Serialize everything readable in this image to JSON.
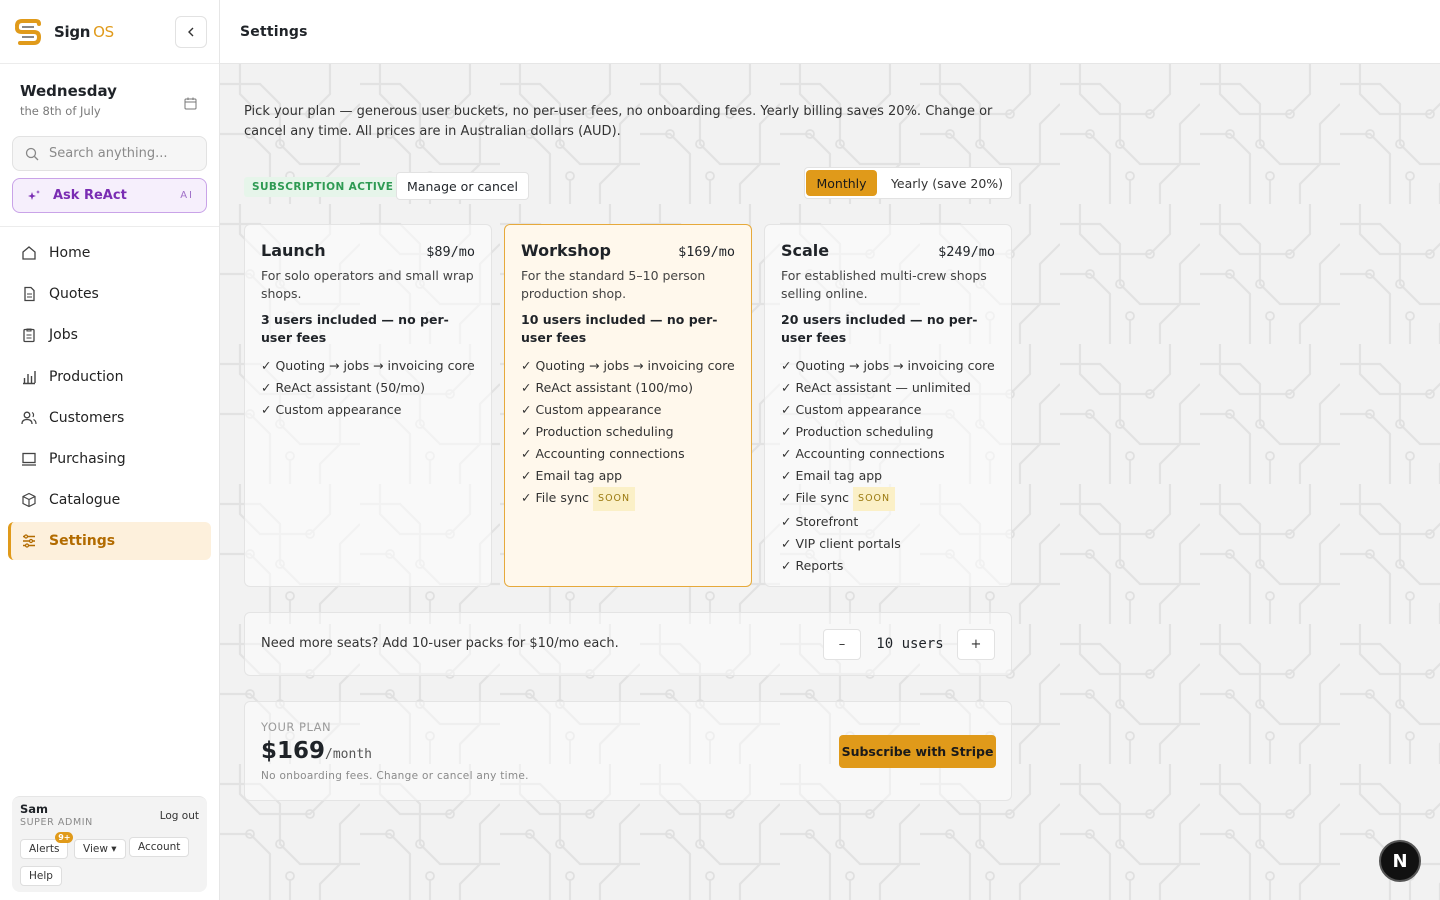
{
  "brand": {
    "name": "Sign",
    "suffix": "OS"
  },
  "header": {
    "title": "Settings"
  },
  "date": {
    "day": "Wednesday",
    "sub": "the 8th of July"
  },
  "search": {
    "placeholder": "Search anything..."
  },
  "ask": {
    "label": "Ask ReAct",
    "tag": "AI"
  },
  "sidebar": {
    "items": [
      {
        "label": "Home",
        "icon": "home-icon"
      },
      {
        "label": "Quotes",
        "icon": "document-icon"
      },
      {
        "label": "Jobs",
        "icon": "clipboard-icon"
      },
      {
        "label": "Production",
        "icon": "bar-chart-icon"
      },
      {
        "label": "Customers",
        "icon": "users-icon"
      },
      {
        "label": "Purchasing",
        "icon": "monitor-icon"
      },
      {
        "label": "Catalogue",
        "icon": "box-icon"
      },
      {
        "label": "Settings",
        "icon": "sliders-icon",
        "active": true
      }
    ]
  },
  "user": {
    "name": "Sam",
    "role": "SUPER ADMIN",
    "logout": "Log out",
    "alerts": "Alerts",
    "alerts_badge": "9+",
    "view": "View ▾",
    "account": "Account",
    "help": "Help"
  },
  "main": {
    "intro": "Pick your plan — generous user buckets, no per-user fees, no onboarding fees. Yearly billing saves 20%. Change or cancel any time. All prices are in Australian dollars (AUD).",
    "status": "SUBSCRIPTION ACTIVE",
    "manage": "Manage or cancel",
    "billing": {
      "monthly": "Monthly",
      "yearly": "Yearly (save 20%)",
      "selected": "Monthly"
    },
    "plans": [
      {
        "name": "Launch",
        "price": "$89/mo",
        "desc": "For solo operators and small wrap shops.",
        "users": "3 users included — no per-user fees",
        "features": [
          "✓ Quoting → jobs → invoicing core",
          "✓ ReAct assistant (50/mo)",
          "✓ Custom appearance"
        ]
      },
      {
        "name": "Workshop",
        "price": "$169/mo",
        "desc": "For the standard 5–10 person production shop.",
        "users": "10 users included — no per-user fees",
        "features": [
          "✓ Quoting → jobs → invoicing core",
          "✓ ReAct assistant (100/mo)",
          "✓ Custom appearance",
          "✓ Production scheduling",
          "✓ Accounting connections",
          "✓ Email tag app",
          "✓ File sync"
        ],
        "soon_feature": 6
      },
      {
        "name": "Scale",
        "price": "$249/mo",
        "desc": "For established multi-crew shops selling online.",
        "users": "20 users included — no per-user fees",
        "features": [
          "✓ Quoting → jobs → invoicing core",
          "✓ ReAct assistant — unlimited",
          "✓ Custom appearance",
          "✓ Production scheduling",
          "✓ Accounting connections",
          "✓ Email tag app",
          "✓ File sync",
          "✓ Storefront",
          "✓ VIP client portals",
          "✓ Reports"
        ],
        "soon_feature": 6
      }
    ],
    "soon_label": "SOON",
    "seats": {
      "text": "Need more seats? Add 10-user packs for $10/mo each.",
      "minus": "–",
      "count": "10 users",
      "plus": "+"
    },
    "your_plan": {
      "label": "YOUR PLAN",
      "price": "$169",
      "per": "/month",
      "note": "No onboarding fees. Change or cancel any time.",
      "cta": "Subscribe with Stripe"
    }
  },
  "fab": {
    "label": "N"
  },
  "colors": {
    "accent": "#e09a1a",
    "success": "#2e9a53",
    "ai": "#7a2db3"
  }
}
